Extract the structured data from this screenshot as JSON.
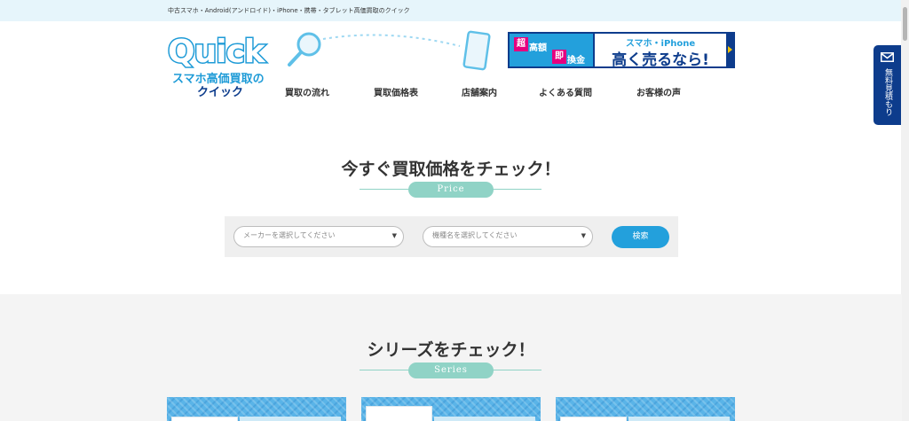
{
  "header": {
    "tagline": "中古スマホ・Android(アンドロイド)・iPhone・携帯・タブレット高価買取のクイック",
    "logo": {
      "word": "Quick",
      "sub1": "スマホ高価買取の",
      "sub2": "クイック"
    },
    "banner": {
      "badge1": "超",
      "word1": "高額",
      "badge2": "即",
      "word2": "換金",
      "line1": "スマホ・iPhone",
      "line2": "高く売るなら!"
    },
    "nav": [
      {
        "label": "買取の流れ"
      },
      {
        "label": "買取価格表"
      },
      {
        "label": "店舗案内"
      },
      {
        "label": "よくある質問"
      },
      {
        "label": "お客様の声"
      }
    ]
  },
  "side_tab": {
    "label": "無料見積もり",
    "icon": "mail-icon"
  },
  "price_section": {
    "title": "今すぐ買取価格をチェック！",
    "pill": "Price",
    "maker_select": {
      "value": "メーカーを選択してください"
    },
    "model_select": {
      "value": "機種名を選択してください"
    },
    "search_label": "検索"
  },
  "series_section": {
    "title": "シリーズをチェック！",
    "pill": "Series"
  },
  "colors": {
    "accent": "#23a0dc",
    "navy": "#0d3c8c",
    "mint": "#90d3c6",
    "topbar": "#e6f5fb"
  }
}
